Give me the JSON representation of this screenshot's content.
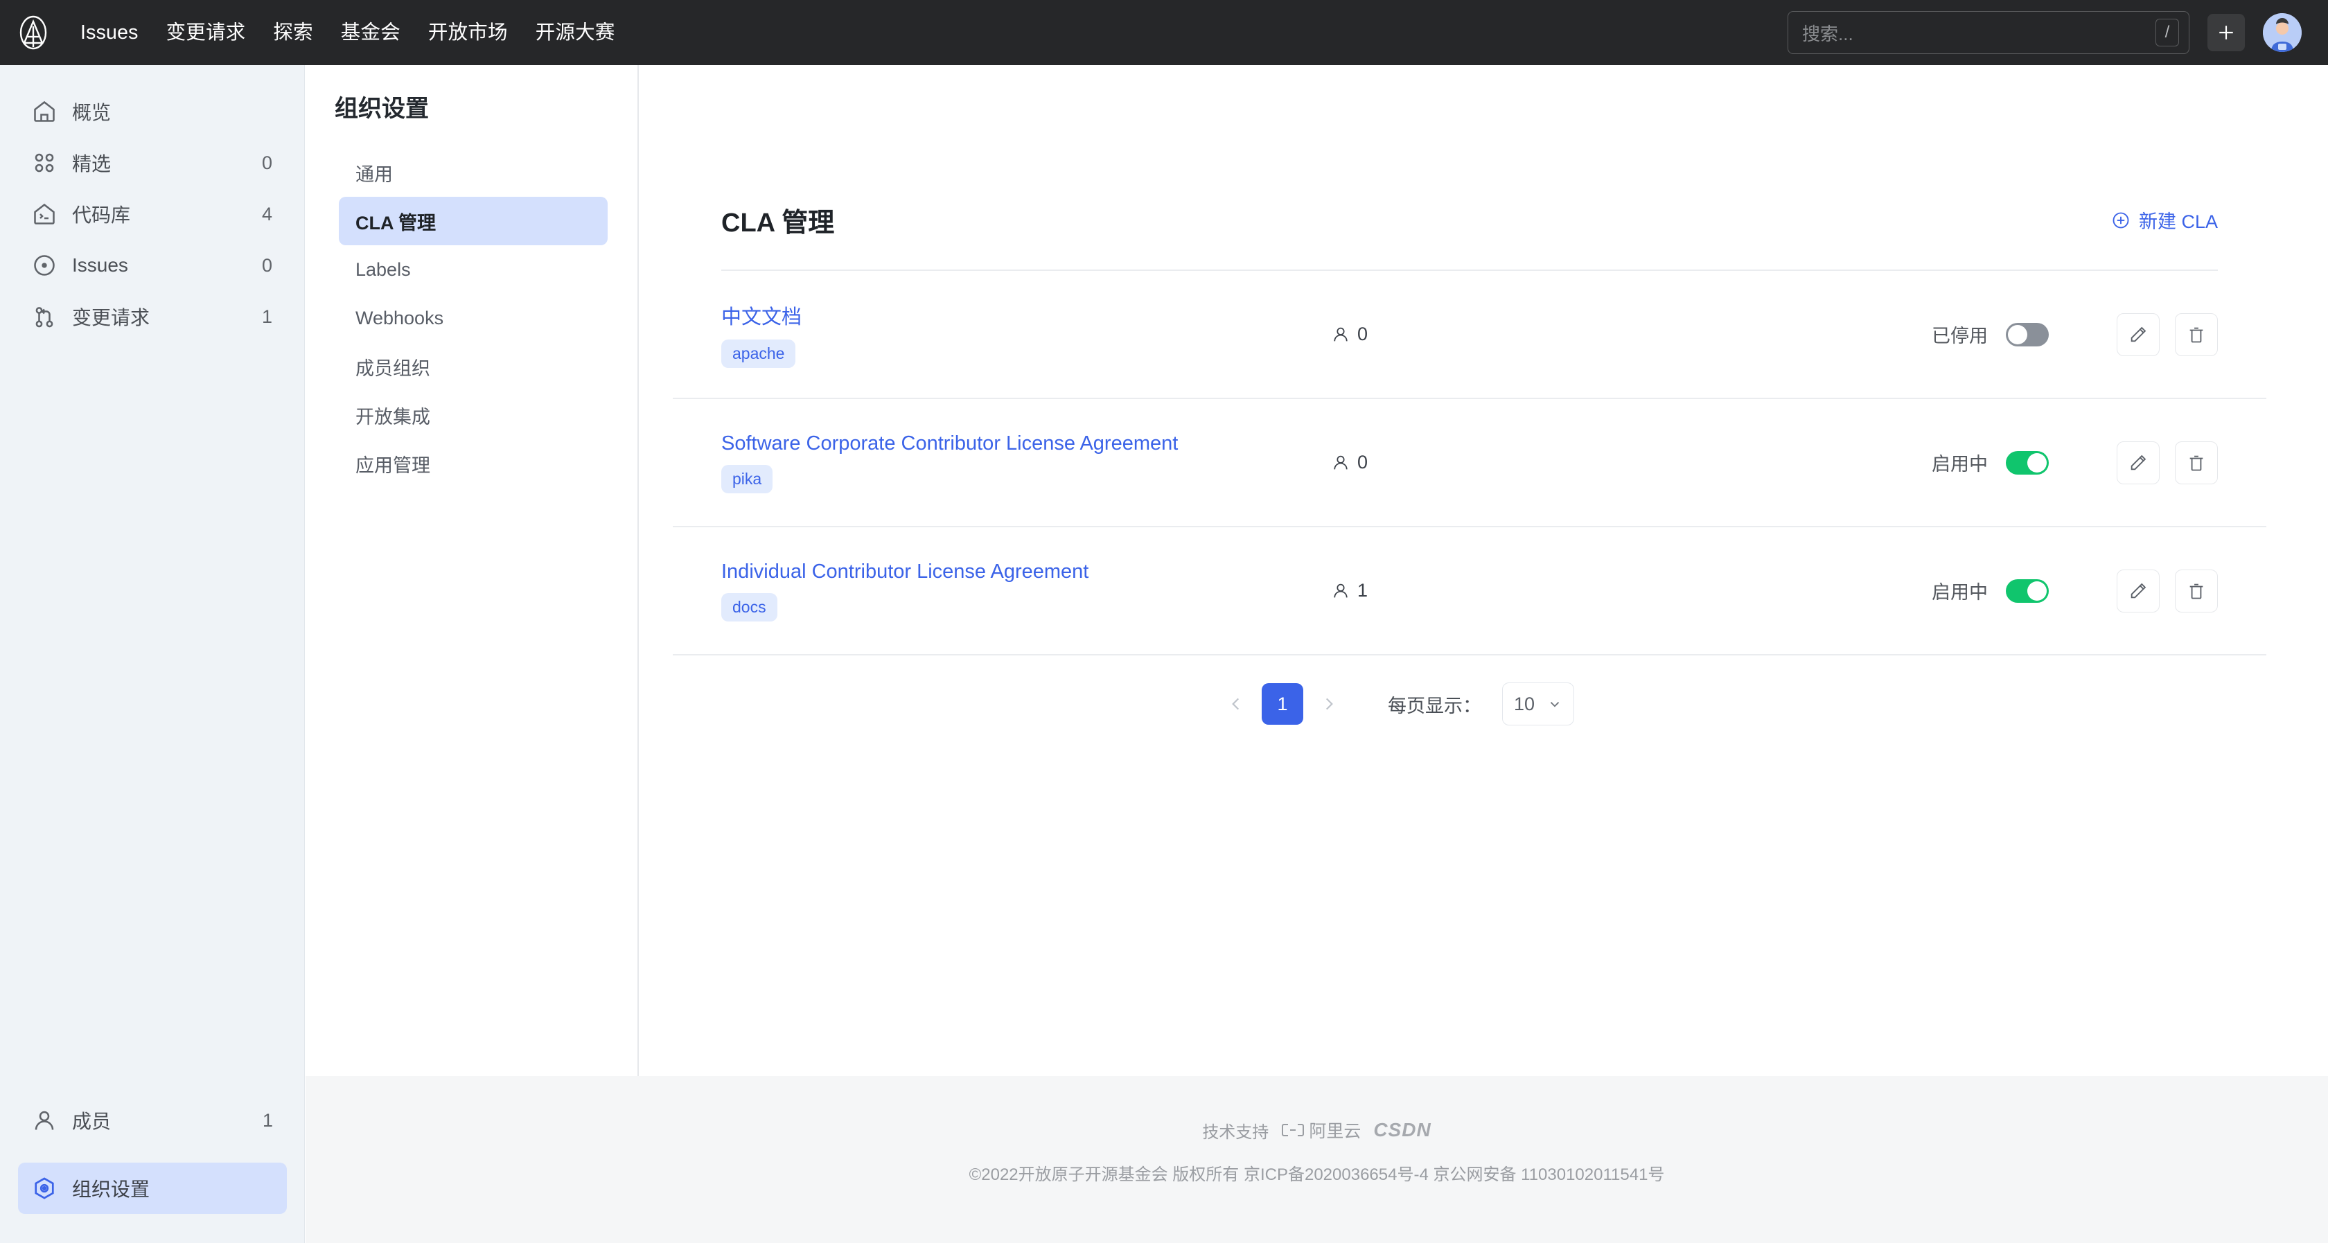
{
  "header": {
    "logo_icon": "openatom-circle-a-logo",
    "nav": [
      {
        "label": "Issues"
      },
      {
        "label": "变更请求"
      },
      {
        "label": "探索"
      },
      {
        "label": "基金会"
      },
      {
        "label": "开放市场"
      },
      {
        "label": "开源大赛"
      }
    ],
    "search": {
      "placeholder": "搜索...",
      "value": "",
      "shortcut": "/"
    },
    "add_button_label": "+",
    "avatar_alt": "user-avatar"
  },
  "sidebar": {
    "items": [
      {
        "label": "概览",
        "count": "",
        "icon": "home-icon",
        "active": false
      },
      {
        "label": "精选",
        "count": "0",
        "icon": "grid-icon",
        "active": false
      },
      {
        "label": "代码库",
        "count": "4",
        "icon": "repo-icon",
        "active": false
      },
      {
        "label": "Issues",
        "count": "0",
        "icon": "issue-circle-icon",
        "active": false
      },
      {
        "label": "变更请求",
        "count": "1",
        "icon": "pull-request-icon",
        "active": false
      }
    ],
    "bottom_items": [
      {
        "label": "成员",
        "count": "1",
        "icon": "person-icon",
        "active": false
      },
      {
        "label": "组织设置",
        "count": "",
        "icon": "settings-hex-icon",
        "active": true
      }
    ]
  },
  "page": {
    "title": "组织设置",
    "settings_nav": [
      {
        "label": "通用",
        "active": false
      },
      {
        "label": "CLA 管理",
        "active": true
      },
      {
        "label": "Labels",
        "active": false
      },
      {
        "label": "Webhooks",
        "active": false
      },
      {
        "label": "成员组织",
        "active": false
      },
      {
        "label": "开放集成",
        "active": false
      },
      {
        "label": "应用管理",
        "active": false
      }
    ]
  },
  "content": {
    "title": "CLA 管理",
    "new_button_label": "新建 CLA",
    "new_button_icon": "circle-plus-icon",
    "rows": [
      {
        "name": "中文文档",
        "tag": "apache",
        "member_count": "0",
        "status_label": "已停用",
        "enabled": false,
        "edit_icon": "pencil-icon",
        "delete_icon": "trash-icon"
      },
      {
        "name": "Software Corporate Contributor License Agreement",
        "tag": "pika",
        "member_count": "0",
        "status_label": "启用中",
        "enabled": true,
        "edit_icon": "pencil-icon",
        "delete_icon": "trash-icon"
      },
      {
        "name": "Individual Contributor License Agreement",
        "tag": "docs",
        "member_count": "1",
        "status_label": "启用中",
        "enabled": true,
        "edit_icon": "pencil-icon",
        "delete_icon": "trash-icon"
      }
    ],
    "pagination": {
      "prev_icon": "chevron-left-icon",
      "next_icon": "chevron-right-icon",
      "current_page": "1",
      "per_page_label": "每页显示：",
      "per_page_value": "10"
    }
  },
  "footer": {
    "support_label": "技术支持",
    "aliyun_label": "阿里云",
    "csdn_label": "CSDN",
    "copyright": "©2022开放原子开源基金会 版权所有  京ICP备2020036654号-4  京公网安备 11030102011541号"
  },
  "colors": {
    "accent_blue": "#3b63e8",
    "toggle_on_green": "#10c56d",
    "toggle_off_gray": "#8a9099",
    "header_dark": "#262729",
    "sidebar_bg": "#eff3f7",
    "active_nav_bg": "#d4e0fd"
  }
}
